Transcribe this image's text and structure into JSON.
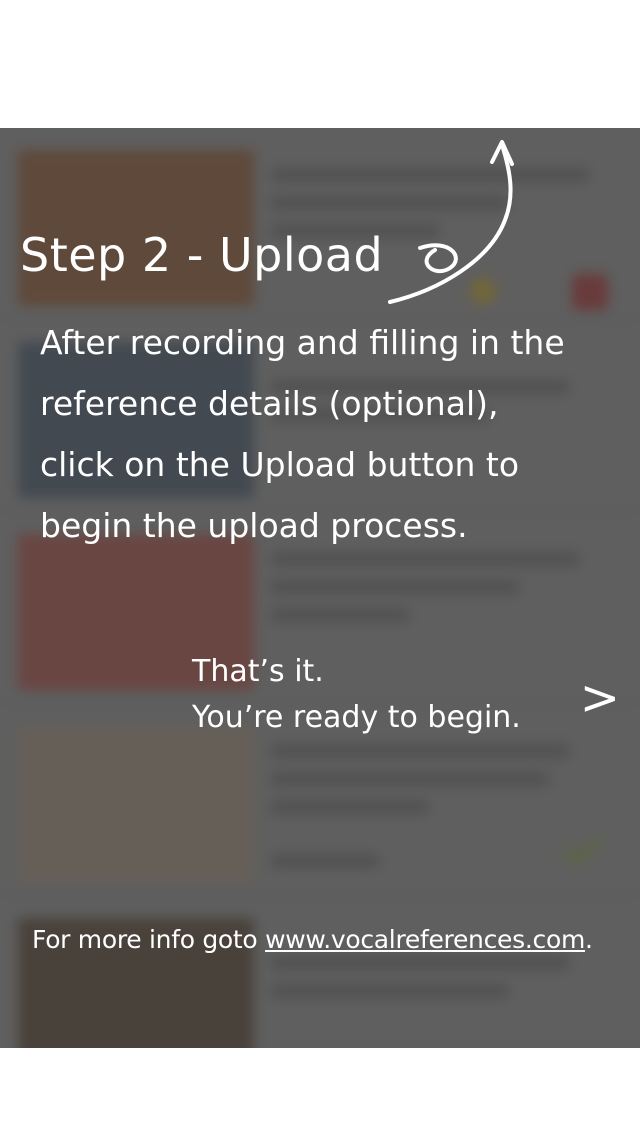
{
  "tutorial": {
    "title": "Step 2 - Upload",
    "body_lines": [
      "After recording and filling in the",
      "reference details (optional),",
      "click on the Upload button to",
      "begin the upload process."
    ],
    "done_line_1": "That’s it.",
    "done_line_2": "You’re ready to begin.",
    "next_symbol": ">",
    "info_prefix": "For more info goto ",
    "info_link": "www.vocalreferences.com",
    "info_suffix": "."
  },
  "background": {
    "overlay_color": "#3c3c3c",
    "thumb_colors": [
      "#8b5a3a",
      "#4a5a6a",
      "#a0524a",
      "#9a8a7a",
      "#5a4a3a"
    ],
    "star_color": "#b59a32",
    "action_color": "#a13a3a",
    "check_color": "#7f9a3a"
  }
}
